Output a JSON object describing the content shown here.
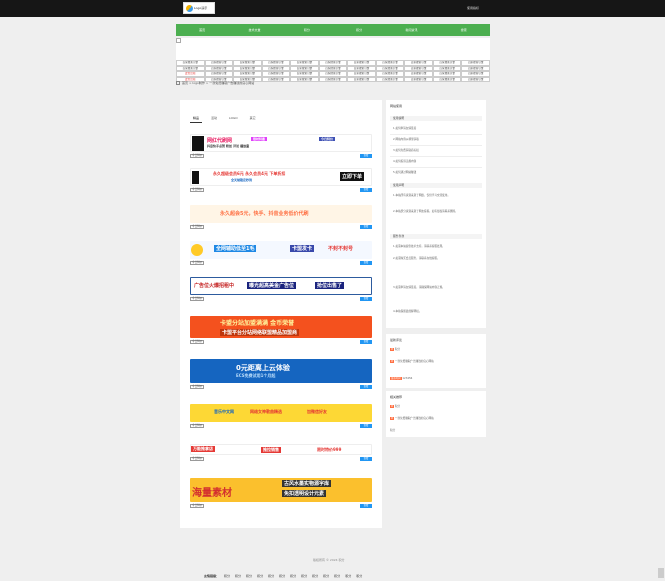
{
  "topbar": {
    "logo_text": "Logo演示",
    "logo_sub": "www.example.com",
    "link": "使用指标"
  },
  "nav": [
    "首页",
    "技术文章",
    "积分",
    "积分",
    "新闻资讯",
    "搜索"
  ],
  "ads": {
    "rows": [
      [
        "百家搜索引擎",
        "百家搜索引擎",
        "百家搜索引擎",
        "百家搜索引擎",
        "百家搜索引擎",
        "百家搜索引擎",
        "百家搜索引擎",
        "百家搜索引擎",
        "百家搜索引擎",
        "百家搜索引擎",
        "百家搜索引擎"
      ],
      [
        "百家搜索引擎",
        "百家搜索引擎",
        "百家搜索引擎",
        "百家搜索引擎",
        "百家搜索引擎",
        "百家搜索引擎",
        "百家搜索引擎",
        "百家搜索引擎",
        "百家搜索引擎",
        "百家搜索引擎",
        "百家搜索引擎"
      ],
      [
        "此位出租",
        "百家搜索引擎",
        "百家搜索引擎",
        "百家搜索引擎",
        "百家搜索引擎",
        "百家搜索引擎",
        "百家搜索引擎",
        "百家搜索引擎",
        "百家搜索引擎",
        "百家搜索引擎",
        "百家搜索引擎"
      ],
      [
        "此位出租",
        "百家搜索引擎",
        "百家搜索引擎",
        "百家搜索引擎",
        "百家搜索引擎",
        "百家搜索引擎",
        "百家搜索引擎",
        "百家搜索引擎",
        "百家搜索引擎",
        "百家搜索引擎",
        "百家搜索引擎"
      ]
    ]
  },
  "breadcrumb": "首页 > logo制作 > 一款免费赚取广告赚钱的良心网站",
  "tabs": [
    "精品",
    "活动",
    "LOGO",
    "其它"
  ],
  "items": [
    {
      "text1": "网红代刷网",
      "text2": "抖音快手点赞 粉丝 评论 播放量",
      "text3": "限时特惠",
      "tag": "今日特价",
      "btn": "查看"
    },
    {
      "text1": "永久超级会员6元 永久会员4元 下单折扣",
      "text2": "全天候稳定秒到",
      "text3": "立即下单",
      "tag": "今日特价",
      "btn": "查看"
    },
    {
      "text1": "永久超会5元，快手、抖音业务低价代刷",
      "text2": "",
      "text3": "",
      "tag": "今日特价",
      "btn": "查看"
    },
    {
      "text1": "全网辅助低至1毛",
      "text2": "卡盟发卡",
      "text3": "不封不封号",
      "tag": "今日特价",
      "btn": "查看"
    },
    {
      "text1": "广告位火爆招租中",
      "text2": "曝光超高美金广告位",
      "text3": "抢位出售了",
      "tag": "今日特价",
      "btn": "查看"
    },
    {
      "text1": "卡盟分站加盟满满 金币荣誉",
      "text2": "卡盟平台分站网络联盟精品加盟商",
      "text3": "",
      "tag": "今日特价",
      "btn": "查看"
    },
    {
      "text1": "0元距离上云体验",
      "text2": "ECS免费试用1个月起",
      "text3": "",
      "tag": "今日特价",
      "btn": "查看"
    },
    {
      "text1": "音乐中文网",
      "text2": "网络女神歌曲精选",
      "text3": "加微信好友",
      "tag": "今日特价",
      "btn": "查看"
    },
    {
      "text1": "万能推拿店",
      "text2": "推拉销售",
      "text3": "限时特价999",
      "tag": "今日特价",
      "btn": "查看"
    },
    {
      "text1": "海量素材",
      "text2": "古风水墨实物源字库",
      "text3": "免扣透明设计元素",
      "tag": "今日特价",
      "btn": "查看"
    }
  ],
  "sidebar": {
    "title": "网站使用",
    "h1": "使用说明",
    "links": [
      "1.如何申请友情链接",
      "2.网站内容从哪里获取",
      "3.如何免费获取商标权",
      "4.如何投诉违规内容",
      "5.如何通过网站赚钱"
    ],
    "h2": "使用声明",
    "p1": "1.本站所有资源来源于网络，仅供学习交流使用。",
    "p2": "2.本站部分资源来源于网友投稿，如有侵权请联系删除。",
    "h3": "服务条款",
    "p3": "1.如需本站提供技术支持，请联系客服处理。",
    "p4": "2.如需购买会员服务，请联系在线客服。",
    "p5": "3.如需申请友情链接，请确保网站内容正规。",
    "p6": "4.本站保留最终解释权。"
  },
  "box2": {
    "title": "最新评论",
    "l1": "积分",
    "l2": "一款免费赚取广告赚钱的良心网站",
    "l3": "发布时间",
    "l4": "123456"
  },
  "box3": {
    "title": "相关推荐",
    "l1": "积分",
    "l2": "一款免费赚取广告赚钱的良心网站",
    "l3": "积分"
  },
  "footer": "版权所有 © 2024 积分",
  "links_label": "友情链接：",
  "links": [
    "积分",
    "积分",
    "积分",
    "积分",
    "积分",
    "积分",
    "积分",
    "积分",
    "积分",
    "积分",
    "积分",
    "积分",
    "积分"
  ],
  "colors": {
    "nav": "#4caf50",
    "topbar": "#161616",
    "btn": "#2196f3"
  }
}
